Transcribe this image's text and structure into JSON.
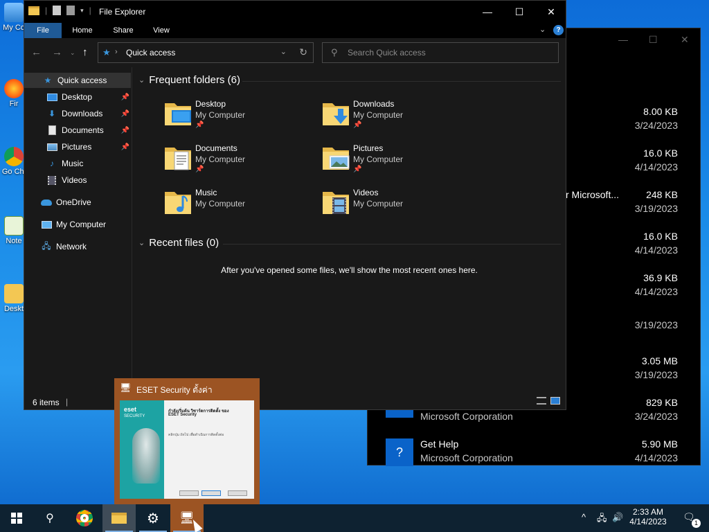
{
  "desktop": {
    "icons": [
      {
        "label": "My Co",
        "icon": "computer-icon"
      },
      {
        "label": "Fir",
        "icon": "firefox-icon"
      },
      {
        "label": "Go Chi",
        "icon": "chrome-icon"
      },
      {
        "label": "Note",
        "icon": "notepad-icon"
      },
      {
        "label": "Deskt",
        "icon": "folder-icon"
      }
    ]
  },
  "background_window": {
    "rows": [
      {
        "name": "",
        "publisher": "",
        "size": "8.00 KB",
        "date": "3/24/2023"
      },
      {
        "name": "",
        "publisher": "",
        "size": "16.0 KB",
        "date": "4/14/2023"
      },
      {
        "name": "r Microsoft...",
        "publisher": "",
        "size": "248 KB",
        "date": "3/19/2023"
      },
      {
        "name": "",
        "publisher": "",
        "size": "16.0 KB",
        "date": "4/14/2023"
      },
      {
        "name": "",
        "publisher": "",
        "size": "36.9 KB",
        "date": "4/14/2023"
      },
      {
        "name": "",
        "publisher": "",
        "size": "",
        "date": "3/19/2023"
      },
      {
        "name": "",
        "publisher": "",
        "size": "3.05 MB",
        "date": "3/19/2023"
      },
      {
        "name": "",
        "publisher": "Microsoft Corporation",
        "size": "829 KB",
        "date": "3/24/2023"
      },
      {
        "name": "Get Help",
        "publisher": "Microsoft Corporation",
        "size": "5.90 MB",
        "date": "4/14/2023"
      }
    ]
  },
  "explorer": {
    "title": "File Explorer",
    "ribbon_tabs": [
      "File",
      "Home",
      "Share",
      "View"
    ],
    "address": {
      "path": "Quick access"
    },
    "search": {
      "placeholder": "Search Quick access"
    },
    "nav": {
      "quick_access": "Quick access",
      "pinned": [
        {
          "label": "Desktop",
          "icon": "desktop-icon",
          "pinned": true
        },
        {
          "label": "Downloads",
          "icon": "downloads-icon",
          "pinned": true
        },
        {
          "label": "Documents",
          "icon": "documents-icon",
          "pinned": true
        },
        {
          "label": "Pictures",
          "icon": "pictures-icon",
          "pinned": true
        },
        {
          "label": "Music",
          "icon": "music-icon",
          "pinned": false
        },
        {
          "label": "Videos",
          "icon": "videos-icon",
          "pinned": false
        }
      ],
      "onedrive": "OneDrive",
      "my_computer": "My Computer",
      "network": "Network"
    },
    "frequent": {
      "header": "Frequent folders (6)",
      "folders": [
        {
          "name": "Desktop",
          "location": "My Computer",
          "pinned": true,
          "icon": "desktop-folder-icon"
        },
        {
          "name": "Downloads",
          "location": "My Computer",
          "pinned": true,
          "icon": "downloads-folder-icon"
        },
        {
          "name": "Documents",
          "location": "My Computer",
          "pinned": true,
          "icon": "documents-folder-icon"
        },
        {
          "name": "Pictures",
          "location": "My Computer",
          "pinned": true,
          "icon": "pictures-folder-icon"
        },
        {
          "name": "Music",
          "location": "My Computer",
          "pinned": false,
          "icon": "music-folder-icon"
        },
        {
          "name": "Videos",
          "location": "My Computer",
          "pinned": false,
          "icon": "videos-folder-icon"
        }
      ]
    },
    "recent": {
      "header": "Recent files (0)",
      "empty_message": "After you've opened some files, we'll show the most recent ones here."
    },
    "status": {
      "count": "6 items",
      "separator": "|"
    }
  },
  "eset_preview": {
    "title": "ESET Security ตั้งค่า",
    "brand": "eset",
    "brand_sub": "SECURITY",
    "heading": "กำลังเริ่มต้น วิซาร์ดการติดตั้ง ของ",
    "heading2": "ESET Security",
    "body": "คลิกปุ่ม ถัดไป เพื่อดำเนินการติดตั้งต่อ"
  },
  "taskbar": {
    "clock_time": "2:33 AM",
    "clock_date": "4/14/2023",
    "notification_count": "1"
  },
  "colors": {
    "accent": "#1f5a96",
    "eset_orange": "#9c5423",
    "taskbar": "#0e2231"
  }
}
